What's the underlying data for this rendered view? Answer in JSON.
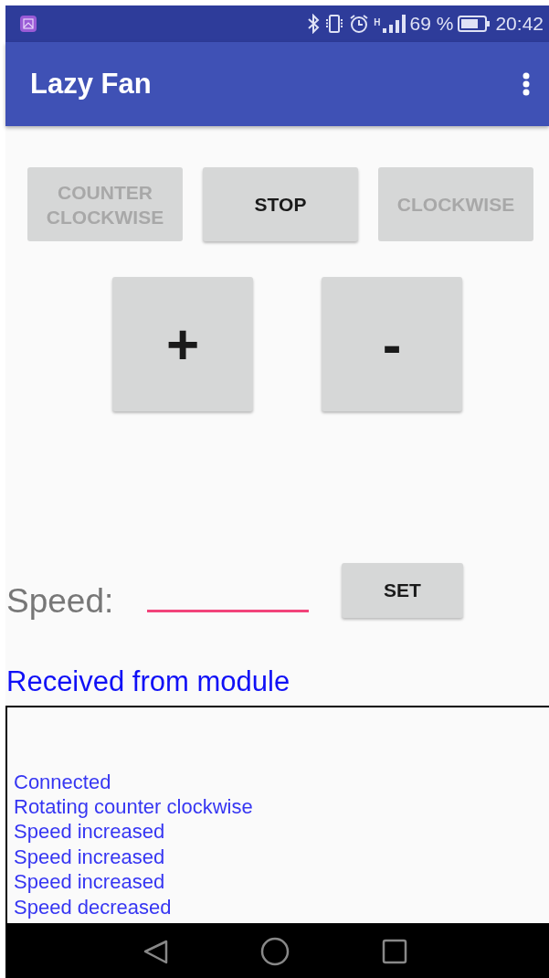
{
  "status_bar": {
    "battery": "69 %",
    "time": "20:42",
    "network": "H"
  },
  "app_bar": {
    "title": "Lazy Fan"
  },
  "direction_buttons": [
    {
      "label": "COUNTER CLOCKWISE",
      "disabled": true
    },
    {
      "label": "STOP",
      "disabled": false
    },
    {
      "label": "CLOCKWISE",
      "disabled": true
    }
  ],
  "speed_buttons": [
    {
      "label": "+"
    },
    {
      "label": "-"
    }
  ],
  "speed": {
    "label": "Speed:",
    "button": "SET"
  },
  "log": {
    "title": "Received from module",
    "lines": [
      "Connected",
      "Rotating counter clockwise",
      "Speed increased",
      "Speed increased",
      "Speed increased",
      "Speed decreased"
    ]
  }
}
